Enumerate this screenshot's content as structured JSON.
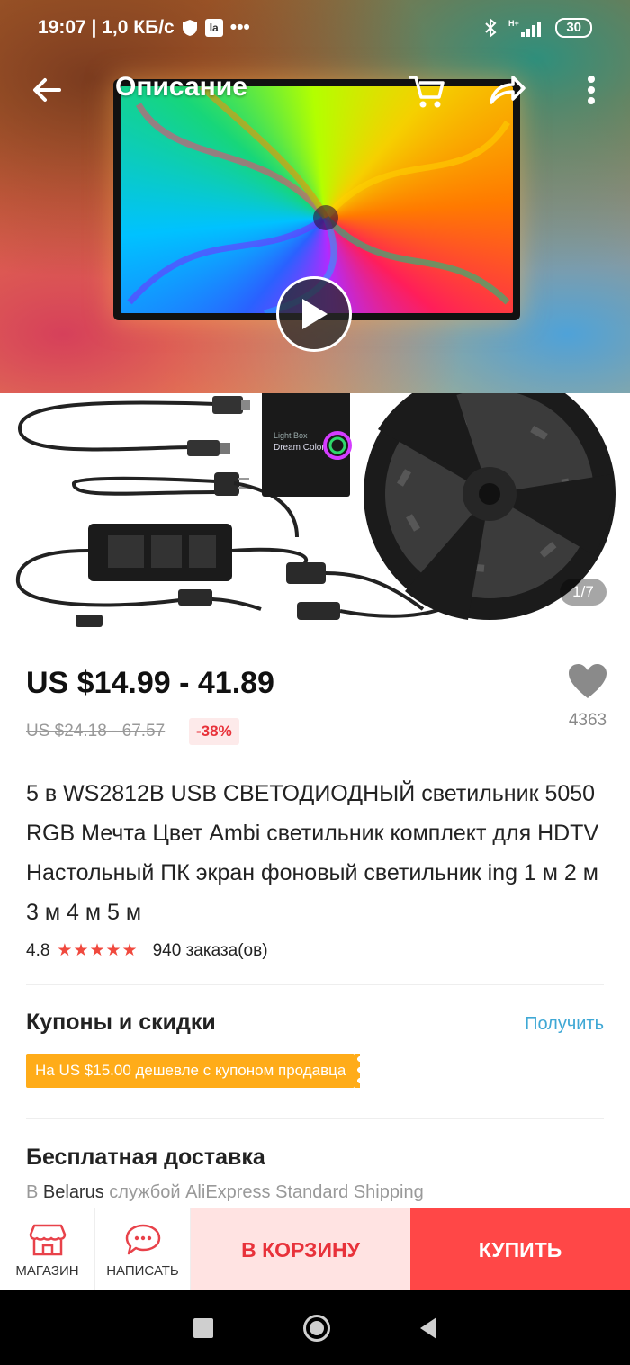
{
  "status_bar": {
    "time_speed": "19:07 | 1,0 КБ/с",
    "battery": "30",
    "network": "H+"
  },
  "header": {
    "title": "Описание"
  },
  "gallery": {
    "counter": "1/7",
    "box_label_1": "Light Box",
    "box_label_2": "Dream Color"
  },
  "product": {
    "price": "US $14.99 - 41.89",
    "old_price": "US $24.18 - 67.57",
    "discount": "-38%",
    "wishlist_count": "4363",
    "title": "5 в WS2812B USB СВЕТОДИОДНЫЙ светильник 5050 RGB Мечта Цвет Ambi светильник комплект для HDTV Настольный ПК экран фоновый светильник ing 1 м 2 м 3 м 4 м 5 м",
    "rating": "4.8",
    "stars": "★★★★★",
    "orders": "940 заказа(ов)"
  },
  "coupons": {
    "title": "Купоны и скидки",
    "get_label": "Получить",
    "coupon_text": "На US $15.00 дешевле с купоном продавца"
  },
  "shipping": {
    "title": "Бесплатная доставка",
    "prefix": "В",
    "country": "Belarus",
    "suffix": "службой AliExpress Standard Shipping"
  },
  "actions": {
    "store_label": "МАГАЗИН",
    "message_label": "НАПИСАТЬ",
    "add_to_cart_label": "В КОРЗИНУ",
    "buy_label": "КУПИТЬ"
  },
  "colors": {
    "accent_red": "#ff4747",
    "cart_bg": "#ffe3e2",
    "coupon_orange": "#ffac19",
    "link_blue": "#3fa8d5"
  }
}
